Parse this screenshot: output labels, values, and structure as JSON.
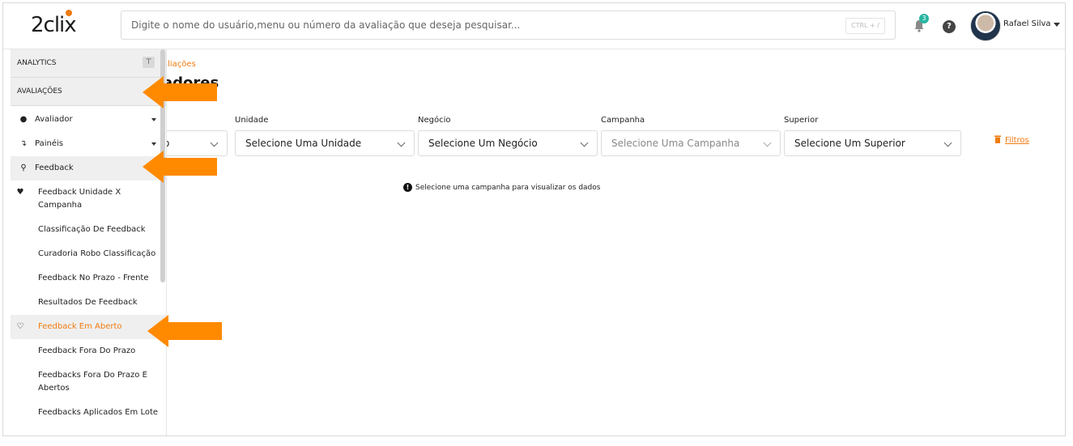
{
  "header": {
    "logo_text": "2clix",
    "search_placeholder": "Digite o nome do usuário,menu ou número da avaliação que deseja pesquisar...",
    "search_shortcut": "CTRL + /",
    "notification_count": "3",
    "help_label": "?",
    "user_name": "Rafael Silva"
  },
  "sidebar": {
    "section_analytics": "ANALYTICS",
    "section_avaliacoes": "AVALIAÇÕES",
    "items": [
      {
        "label": "Avaliador",
        "icon": "user-circle-icon"
      },
      {
        "label": "Painéis",
        "icon": "chart-line-icon"
      },
      {
        "label": "Feedback",
        "icon": "feedback-icon"
      }
    ],
    "sub_items": [
      {
        "label": "Feedback Unidade X Campanha",
        "icon": "heart-icon"
      },
      {
        "label": "Classificação De Feedback",
        "icon": ""
      },
      {
        "label": "Curadoria Robo Classificação",
        "icon": ""
      },
      {
        "label": "Feedback No Prazo - Frente",
        "icon": ""
      },
      {
        "label": "Resultados De Feedback",
        "icon": ""
      },
      {
        "label": "Feedback Em Aberto",
        "icon": "heart-outline-icon",
        "active": true
      },
      {
        "label": "Feedback Fora Do Prazo",
        "icon": ""
      },
      {
        "label": "Feedbacks Fora Do Prazo E Abertos",
        "icon": ""
      },
      {
        "label": "Feedbacks Aplicados Em Lote",
        "icon": ""
      }
    ]
  },
  "main": {
    "breadcrumb": "aliações",
    "page_title": "adores",
    "filters": [
      {
        "label": "",
        "value": "o"
      },
      {
        "label": "Unidade",
        "value": "Selecione Uma Unidade"
      },
      {
        "label": "Negócio",
        "value": "Selecione Um Negócio"
      },
      {
        "label": "Campanha",
        "value": "Selecione Uma Campanha"
      },
      {
        "label": "Superior",
        "value": "Selecione Um Superior"
      }
    ],
    "filters_link": "Filtros",
    "notice": "Selecione uma campanha para visualizar os dados"
  },
  "colors": {
    "accent": "#f07b10",
    "badge": "#27b5a2"
  }
}
